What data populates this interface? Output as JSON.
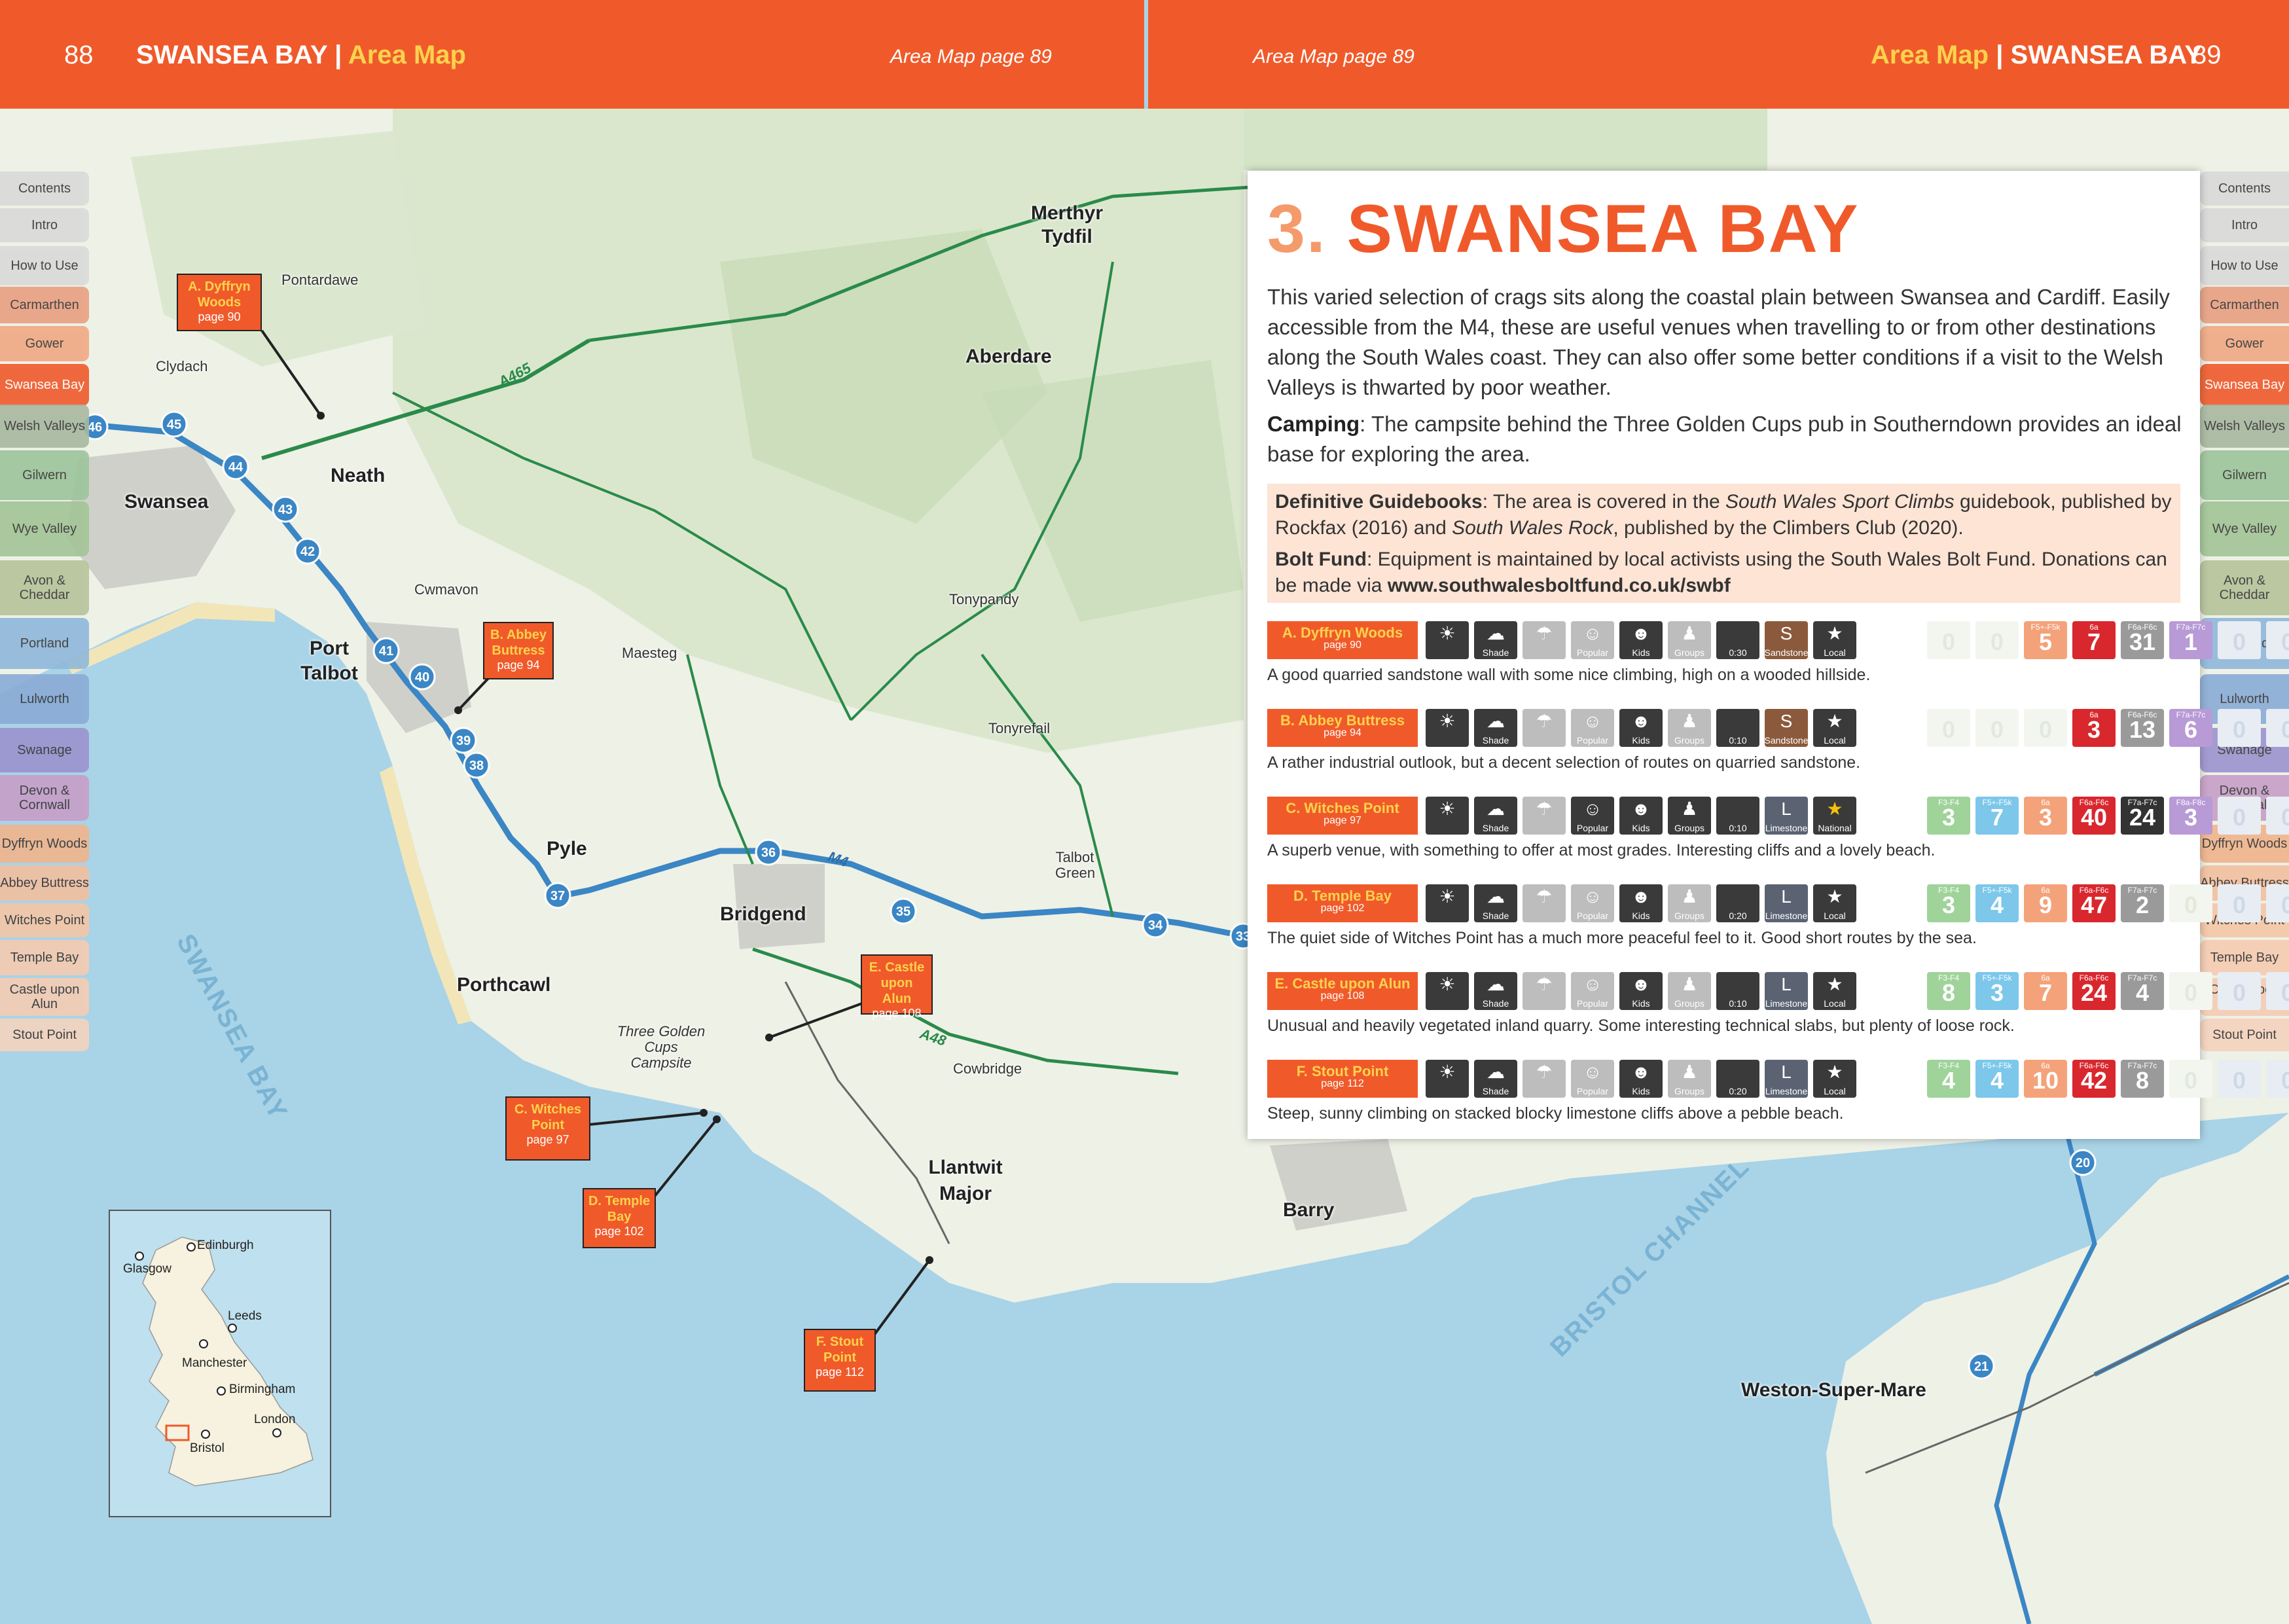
{
  "header": {
    "left_page_num": "88",
    "left_title": "SWANSEA BAY",
    "left_sep": "|",
    "left_section": "Area Map",
    "left_sub": "Area Map page 89",
    "right_sub": "Area Map page 89",
    "right_section": "Area Map",
    "right_sep": "|",
    "right_title": "SWANSEA BAY",
    "right_page_num": "89"
  },
  "tabs": [
    {
      "label": "Contents",
      "color": "#d9d9d9"
    },
    {
      "label": "Intro",
      "color": "#d9d9d9"
    },
    {
      "label": "How to Use",
      "color": "#d9d9d9"
    },
    {
      "label": "Carmarthen",
      "color": "#e8a082"
    },
    {
      "label": "Gower",
      "color": "#f0a884"
    },
    {
      "label": "Swansea Bay",
      "color": "#f05a2b",
      "active": true
    },
    {
      "label": "Welsh Valleys",
      "color": "#a8b8a0"
    },
    {
      "label": "Gilwern",
      "color": "#9cc49a"
    },
    {
      "label": "Wye Valley",
      "color": "#a2c496"
    },
    {
      "label": "Avon & Cheddar",
      "color": "#b6c39a"
    },
    {
      "label": "Portland",
      "color": "#8fb7da"
    },
    {
      "label": "Lulworth",
      "color": "#8aacd6"
    },
    {
      "label": "Swanage",
      "color": "#9b93cf"
    },
    {
      "label": "Devon & Cornwall",
      "color": "#c79ec8"
    },
    {
      "label": "Dyffryn Woods",
      "color": "#f0b48c"
    },
    {
      "label": "Abbey Buttress",
      "color": "#f3c0a0"
    },
    {
      "label": "Witches Point",
      "color": "#f5c6a6"
    },
    {
      "label": "Temple Bay",
      "color": "#f5cbb0"
    },
    {
      "label": "Castle upon Alun",
      "color": "#f5ccb4"
    },
    {
      "label": "Stout Point",
      "color": "#f5d3bd"
    }
  ],
  "map": {
    "towns": [
      "Swansea",
      "Neath",
      "Port Talbot",
      "Pyle",
      "Bridgend",
      "Porthcawl",
      "Merthyr Tydfil",
      "Aberdare",
      "Llantwit Major",
      "Barry",
      "Weston-Super-Mare"
    ],
    "villages": [
      "Pontardawe",
      "Clydach",
      "Cwmavon",
      "Maesteg",
      "Tonypandy",
      "Tonyrefail",
      "Talbot Green",
      "Cowbridge",
      "Three Golden Cups Campsite"
    ],
    "roads": [
      "A465",
      "M4",
      "A48"
    ],
    "junctions": [
      "46",
      "45",
      "44",
      "43",
      "42",
      "41",
      "40",
      "39",
      "38",
      "37",
      "36",
      "35",
      "34",
      "33",
      "20",
      "21"
    ],
    "sea_labels": [
      "SWANSEA BAY",
      "BRISTOL CHANNEL"
    ],
    "callouts": [
      {
        "letter": "A.",
        "name": "Dyffryn Woods",
        "page": "page 90"
      },
      {
        "letter": "B.",
        "name": "Abbey Buttress",
        "page": "page 94"
      },
      {
        "letter": "C.",
        "name": "Witches Point",
        "page": "page 97"
      },
      {
        "letter": "D.",
        "name": "Temple Bay",
        "page": "page 102"
      },
      {
        "letter": "E.",
        "name": "Castle upon Alun",
        "page": "page 108"
      },
      {
        "letter": "F.",
        "name": "Stout Point",
        "page": "page 112"
      }
    ],
    "inset_cities": [
      "Edinburgh",
      "Glasgow",
      "Leeds",
      "Manchester",
      "Birmingham",
      "London",
      "Bristol"
    ]
  },
  "panel": {
    "num": "3.",
    "title": "SWANSEA BAY",
    "intro": "This varied selection of crags sits along the coastal plain between Swansea and Cardiff. Easily accessible from the M4, these are useful venues when travelling to or from other destinations along the South Wales coast. They can also offer some better conditions if a visit to the Welsh Valleys is thwarted by poor weather.",
    "camping_label": "Camping",
    "camping_text": ": The campsite behind the Three Golden Cups pub in Southerndown provides an ideal base for exploring the area.",
    "guide_label": "Definitive Guidebooks",
    "guide_text_1": ": The area is covered in the ",
    "guide_book_1": "South Wales Sport Climbs",
    "guide_text_2": " guidebook, published by Rockfax (2016) and ",
    "guide_book_2": "South Wales Rock",
    "guide_text_3": ", published by the Climbers Club (2020).",
    "bolt_label": "Bolt Fund",
    "bolt_text": ": Equipment is maintained by local activists using the South Wales Bolt Fund. Donations can be made via ",
    "bolt_url": "www.southwalesboltfund.co.uk/swbf"
  },
  "icon_labels": {
    "sun": "",
    "shade": "Shade",
    "rain": "",
    "popular": "Popular",
    "kids": "Kids",
    "groups": "Groups"
  },
  "crags": [
    {
      "title": "A. Dyffryn Woods",
      "page": "page 90",
      "walk": "0:30",
      "rock": "S",
      "rock_label": "Sandstone",
      "status": "Local",
      "popular": false,
      "groups": false,
      "grades": [
        {
          "l": "",
          "v": "0"
        },
        {
          "l": "",
          "v": "0"
        },
        {
          "l": "F5+-F5k",
          "v": "5"
        },
        {
          "l": "6a",
          "v": "7"
        },
        {
          "l": "F6a-F6c",
          "v": "31"
        },
        {
          "l": "F7a-F7c",
          "v": "1"
        },
        {
          "l": "",
          "v": "0"
        },
        {
          "l": "",
          "v": "0"
        }
      ],
      "desc": "A good quarried sandstone wall with some nice climbing, high on a wooded hillside."
    },
    {
      "title": "B. Abbey Buttress",
      "page": "page 94",
      "walk": "0:10",
      "rock": "S",
      "rock_label": "Sandstone",
      "status": "Local",
      "popular": false,
      "groups": false,
      "grades": [
        {
          "l": "",
          "v": "0"
        },
        {
          "l": "",
          "v": "0"
        },
        {
          "l": "",
          "v": "0"
        },
        {
          "l": "6a",
          "v": "3"
        },
        {
          "l": "F6a-F6c",
          "v": "13"
        },
        {
          "l": "F7a-F7c",
          "v": "6"
        },
        {
          "l": "",
          "v": "0"
        },
        {
          "l": "",
          "v": "0"
        }
      ],
      "desc": "A rather industrial outlook, but a decent selection of routes on quarried sandstone."
    },
    {
      "title": "C. Witches Point",
      "page": "page 97",
      "walk": "0:10",
      "rock": "L",
      "rock_label": "Limestone",
      "status": "National",
      "popular": true,
      "groups": true,
      "grades": [
        {
          "l": "F3-F4",
          "v": "3"
        },
        {
          "l": "F5+-F5k",
          "v": "7"
        },
        {
          "l": "6a",
          "v": "3"
        },
        {
          "l": "F6a-F6c",
          "v": "40"
        },
        {
          "l": "F7a-F7c",
          "v": "24"
        },
        {
          "l": "F8a-F8c",
          "v": "3"
        },
        {
          "l": "",
          "v": "0"
        },
        {
          "l": "",
          "v": "0"
        }
      ],
      "desc": "A superb venue, with something to offer at most grades. Interesting cliffs and a lovely beach."
    },
    {
      "title": "D. Temple Bay",
      "page": "page 102",
      "walk": "0:20",
      "rock": "L",
      "rock_label": "Limestone",
      "status": "Local",
      "popular": false,
      "groups": false,
      "grades": [
        {
          "l": "F3-F4",
          "v": "3"
        },
        {
          "l": "F5+-F5k",
          "v": "4"
        },
        {
          "l": "6a",
          "v": "9"
        },
        {
          "l": "F6a-F6c",
          "v": "47"
        },
        {
          "l": "F7a-F7c",
          "v": "2"
        },
        {
          "l": "",
          "v": "0"
        },
        {
          "l": "",
          "v": "0"
        },
        {
          "l": "",
          "v": "0"
        }
      ],
      "desc": "The quiet side of Witches Point has a much more peaceful feel to it. Good short routes by the sea."
    },
    {
      "title": "E. Castle upon Alun",
      "page": "page 108",
      "walk": "0:10",
      "rock": "L",
      "rock_label": "Limestone",
      "status": "Local",
      "popular": false,
      "groups": false,
      "grades": [
        {
          "l": "F3-F4",
          "v": "8"
        },
        {
          "l": "F5+-F5k",
          "v": "3"
        },
        {
          "l": "6a",
          "v": "7"
        },
        {
          "l": "F6a-F6c",
          "v": "24"
        },
        {
          "l": "F7a-F7c",
          "v": "4"
        },
        {
          "l": "",
          "v": "0"
        },
        {
          "l": "",
          "v": "0"
        },
        {
          "l": "",
          "v": "0"
        }
      ],
      "desc": "Unusual and heavily vegetated inland quarry. Some interesting technical slabs, but plenty of loose rock."
    },
    {
      "title": "F. Stout Point",
      "page": "page 112",
      "walk": "0:20",
      "rock": "L",
      "rock_label": "Limestone",
      "status": "Local",
      "popular": false,
      "groups": false,
      "grades": [
        {
          "l": "F3-F4",
          "v": "4"
        },
        {
          "l": "F5+-F5k",
          "v": "4"
        },
        {
          "l": "6a",
          "v": "10"
        },
        {
          "l": "F6a-F6c",
          "v": "42"
        },
        {
          "l": "F7a-F7c",
          "v": "8"
        },
        {
          "l": "",
          "v": "0"
        },
        {
          "l": "",
          "v": "0"
        },
        {
          "l": "",
          "v": "0"
        }
      ],
      "desc": "Steep, sunny climbing on stacked blocky limestone cliffs above a pebble beach."
    }
  ]
}
